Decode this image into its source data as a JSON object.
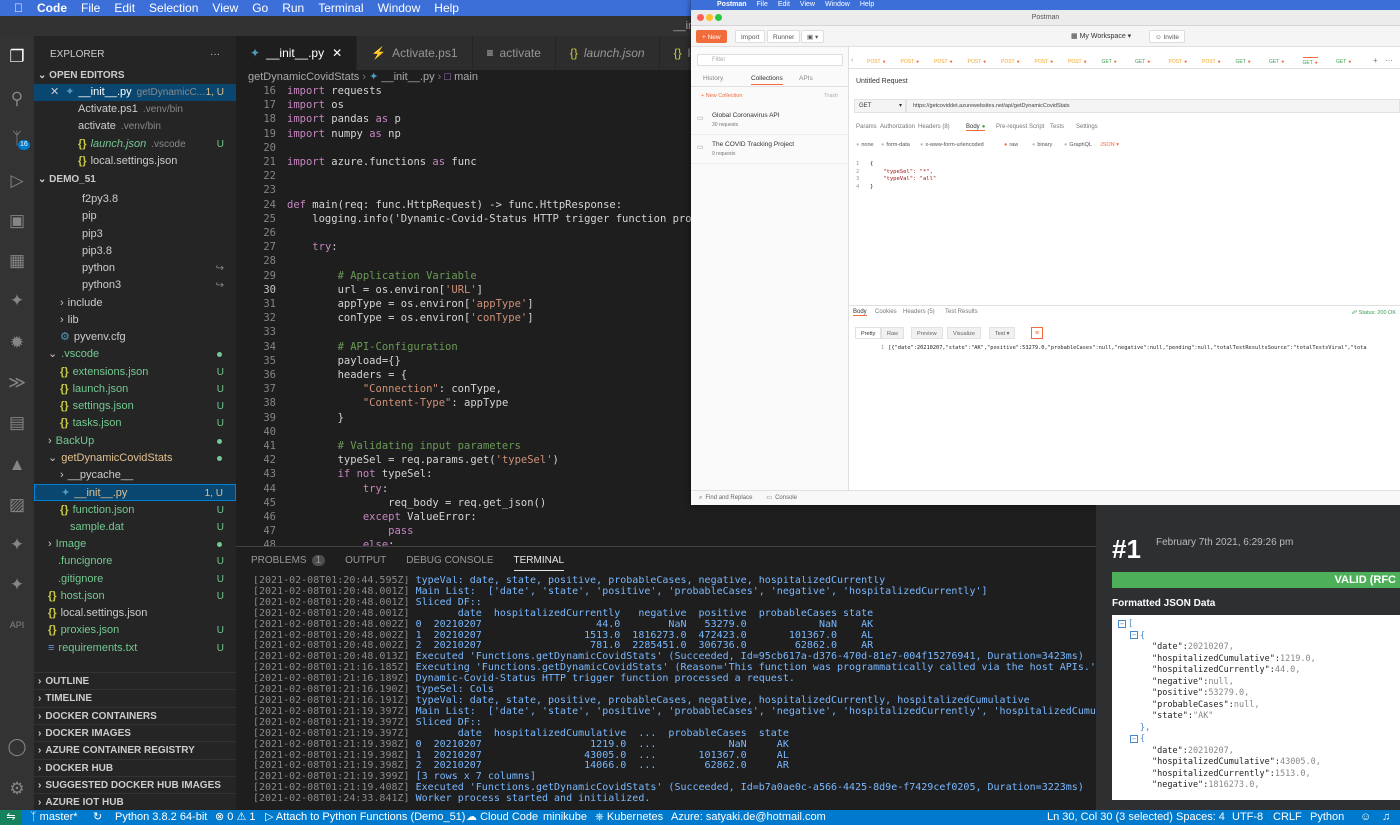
{
  "menubar": {
    "app": "Code",
    "items": [
      "File",
      "Edit",
      "Selection",
      "View",
      "Go",
      "Run",
      "Terminal",
      "Window",
      "Help"
    ]
  },
  "window_title": "__init__.py",
  "activity": {
    "source_control_badge": "16",
    "api_label": "API"
  },
  "explorer": {
    "title": "EXPLORER",
    "more": "···",
    "open_editors_label": "OPEN EDITORS",
    "open_editors": [
      {
        "name": "__init__.py",
        "path": "getDynamicC...",
        "status": "1, U",
        "active": true
      },
      {
        "name": "Activate.ps1",
        "path": ".venv/bin",
        "status": ""
      },
      {
        "name": "activate",
        "path": ".venv/bin",
        "status": ""
      },
      {
        "name": "launch.json",
        "path": ".vscode",
        "status": "U"
      },
      {
        "name": "local.settings.json",
        "path": "",
        "status": ""
      }
    ],
    "project_label": "DEMO_51",
    "tree": [
      {
        "name": "f2py3.8",
        "indent": 2,
        "status": ""
      },
      {
        "name": "pip",
        "indent": 2,
        "status": ""
      },
      {
        "name": "pip3",
        "indent": 2,
        "status": ""
      },
      {
        "name": "pip3.8",
        "indent": 2,
        "status": ""
      },
      {
        "name": "python",
        "indent": 2,
        "status": ""
      },
      {
        "name": "python3",
        "indent": 2,
        "status": ""
      },
      {
        "name": "include",
        "indent": 1,
        "status": ""
      },
      {
        "name": "lib",
        "indent": 1,
        "status": ""
      },
      {
        "name": "pyvenv.cfg",
        "indent": 1,
        "status": ""
      },
      {
        "name": ".vscode",
        "indent": 0,
        "status": "dot"
      },
      {
        "name": "extensions.json",
        "indent": 1,
        "status": "U"
      },
      {
        "name": "launch.json",
        "indent": 1,
        "status": "U"
      },
      {
        "name": "settings.json",
        "indent": 1,
        "status": "U"
      },
      {
        "name": "tasks.json",
        "indent": 1,
        "status": "U"
      },
      {
        "name": "BackUp",
        "indent": 0,
        "status": "dot"
      },
      {
        "name": "getDynamicCovidStats",
        "indent": 0,
        "status": "dot"
      },
      {
        "name": "__pycache__",
        "indent": 1,
        "status": ""
      },
      {
        "name": "__init__.py",
        "indent": 1,
        "status": "1, U"
      },
      {
        "name": "function.json",
        "indent": 1,
        "status": "U"
      },
      {
        "name": "sample.dat",
        "indent": 1,
        "status": "U"
      },
      {
        "name": "Image",
        "indent": 0,
        "status": "dot"
      },
      {
        "name": ".funcignore",
        "indent": 0,
        "status": "U"
      },
      {
        "name": ".gitignore",
        "indent": 0,
        "status": "U"
      },
      {
        "name": "host.json",
        "indent": 0,
        "status": "U"
      },
      {
        "name": "local.settings.json",
        "indent": 0,
        "status": ""
      },
      {
        "name": "proxies.json",
        "indent": 0,
        "status": "U"
      },
      {
        "name": "requirements.txt",
        "indent": 0,
        "status": "U"
      }
    ],
    "sections": [
      "OUTLINE",
      "TIMELINE",
      "DOCKER CONTAINERS",
      "DOCKER IMAGES",
      "AZURE CONTAINER REGISTRY",
      "DOCKER HUB",
      "SUGGESTED DOCKER HUB IMAGES",
      "AZURE IOT HUB"
    ]
  },
  "tabs": [
    "__init__.py",
    "Activate.ps1",
    "activate",
    "launch.json",
    "local.s"
  ],
  "breadcrumbs": {
    "folder": "getDynamicCovidStats",
    "file": "__init__.py",
    "symbol": "main"
  },
  "editor": {
    "current_line": 30,
    "lines": [
      {
        "n": 16,
        "t": "import requests"
      },
      {
        "n": 17,
        "t": "import os"
      },
      {
        "n": 18,
        "t": "import pandas as p"
      },
      {
        "n": 19,
        "t": "import numpy as np"
      },
      {
        "n": 20,
        "t": ""
      },
      {
        "n": 21,
        "t": "import azure.functions as func"
      },
      {
        "n": 22,
        "t": ""
      },
      {
        "n": 23,
        "t": ""
      },
      {
        "n": 24,
        "t": "def main(req: func.HttpRequest) -> func.HttpResponse:"
      },
      {
        "n": 25,
        "t": "    logging.info('Dynamic-Covid-Status HTTP trigger function processed a"
      },
      {
        "n": 26,
        "t": ""
      },
      {
        "n": 27,
        "t": "    try:"
      },
      {
        "n": 28,
        "t": ""
      },
      {
        "n": 29,
        "t": "        # Application Variable"
      },
      {
        "n": 30,
        "t": "        url = os.environ['URL']"
      },
      {
        "n": 31,
        "t": "        appType = os.environ['appType']"
      },
      {
        "n": 32,
        "t": "        conType = os.environ['conType']"
      },
      {
        "n": 33,
        "t": ""
      },
      {
        "n": 34,
        "t": "        # API-Configuration"
      },
      {
        "n": 35,
        "t": "        payload={}"
      },
      {
        "n": 36,
        "t": "        headers = {"
      },
      {
        "n": 37,
        "t": "            \"Connection\": conType,"
      },
      {
        "n": 38,
        "t": "            \"Content-Type\": appType"
      },
      {
        "n": 39,
        "t": "        }"
      },
      {
        "n": 40,
        "t": ""
      },
      {
        "n": 41,
        "t": "        # Validating input parameters"
      },
      {
        "n": 42,
        "t": "        typeSel = req.params.get('typeSel')"
      },
      {
        "n": 43,
        "t": "        if not typeSel:"
      },
      {
        "n": 44,
        "t": "            try:"
      },
      {
        "n": 45,
        "t": "                req_body = req.get_json()"
      },
      {
        "n": 46,
        "t": "            except ValueError:"
      },
      {
        "n": 47,
        "t": "                pass"
      },
      {
        "n": 48,
        "t": "            else:"
      }
    ]
  },
  "panel": {
    "tabs": [
      "PROBLEMS",
      "OUTPUT",
      "DEBUG CONSOLE",
      "TERMINAL"
    ],
    "problems_count": "1",
    "terminal": [
      "[2021-02-08T01:20:44.595Z] typeVal: date, state, positive, probableCases, negative, hospitalizedCurrently",
      "[2021-02-08T01:20:48.001Z] Main List:  ['date', 'state', 'positive', 'probableCases', 'negative', 'hospitalizedCurrently']",
      "[2021-02-08T01:20:48.001Z] Sliced DF::",
      "[2021-02-08T01:20:48.001Z]        date  hospitalizedCurrently   negative  positive  probableCases state",
      "[2021-02-08T01:20:48.002Z] 0  20210207                   44.0        NaN   53279.0            NaN    AK",
      "[2021-02-08T01:20:48.002Z] 1  20210207                 1513.0  1816273.0  472423.0       101367.0    AL",
      "[2021-02-08T01:20:48.002Z] 2  20210207                  781.0  2285451.0  306736.0        62862.0    AR",
      "[2021-02-08T01:20:48.013Z] Executed 'Functions.getDynamicCovidStats' (Succeeded, Id=95cb617a-d376-470d-81e7-004f15276941, Duration=3423ms)",
      "[2021-02-08T01:21:16.185Z] Executing 'Functions.getDynamicCovidStats' (Reason='This function was programmatically called via the host APIs.', Id=b7a0ae0c-",
      "[2021-02-08T01:21:16.189Z] Dynamic-Covid-Status HTTP trigger function processed a request.",
      "[2021-02-08T01:21:16.190Z] typeSel: Cols",
      "[2021-02-08T01:21:16.191Z] typeVal: date, state, positive, probableCases, negative, hospitalizedCurrently, hospitalizedCumulative",
      "[2021-02-08T01:21:19.397Z] Main List:  ['date', 'state', 'positive', 'probableCases', 'negative', 'hospitalizedCurrently', 'hospitalizedCumulative']",
      "[2021-02-08T01:21:19.397Z] Sliced DF::",
      "[2021-02-08T01:21:19.397Z]        date  hospitalizedCumulative  ...  probableCases  state",
      "[2021-02-08T01:21:19.398Z] 0  20210207                  1219.0  ...            NaN     AK",
      "[2021-02-08T01:21:19.398Z] 1  20210207                 43005.0  ...       101367.0     AL",
      "[2021-02-08T01:21:19.398Z] 2  20210207                 14066.0  ...        62862.0     AR",
      "[2021-02-08T01:21:19.399Z] [3 rows x 7 columns]",
      "[2021-02-08T01:21:19.408Z] Executed 'Functions.getDynamicCovidStats' (Succeeded, Id=b7a0ae0c-a566-4425-8d9e-f7429cef0205, Duration=3223ms)",
      "[2021-02-08T01:24:33.841Z] Worker process started and initialized."
    ]
  },
  "statusbar": {
    "branch": "master*",
    "python": "Python 3.8.2 64-bit",
    "errors": "0",
    "warnings": "1",
    "attach": "Attach to Python Functions (Demo_51)",
    "cloud": "Cloud Code",
    "minikube": "minikube",
    "k8s": "Kubernetes",
    "azure": "Azure: satyaki.de@hotmail.com",
    "position": "Ln 30, Col 30 (3 selected)",
    "spaces": "Spaces: 4",
    "encoding": "UTF-8",
    "eol": "CRLF",
    "lang": "Python"
  },
  "postman": {
    "menubar": [
      "Postman",
      "File",
      "Edit",
      "View",
      "Window",
      "Help"
    ],
    "title": "Postman",
    "new_btn": "+ New",
    "import_btn": "Import",
    "runner_btn": "Runner",
    "workspace": "My Workspace",
    "invite": "Invite",
    "filter_placeholder": "Filter",
    "side_tabs": [
      "History",
      "Collections",
      "APIs"
    ],
    "new_collection": "+ New Collection",
    "trash": "Trash",
    "collections": [
      {
        "name": "Global Coronavirus API",
        "count": "30 requests"
      },
      {
        "name": "The COVID Tracking Project",
        "count": "9 requests"
      }
    ],
    "request_name": "Untitled Request",
    "method": "GET",
    "url": "https://getcoviddet.azurewebsites.net/api/getDynamicCovidStats",
    "req_tabs": [
      "Params",
      "Authorization",
      "Headers (8)",
      "Body",
      "Pre-request Script",
      "Tests",
      "Settings"
    ],
    "body_types": [
      "none",
      "form-data",
      "x-www-form-urlencoded",
      "raw",
      "binary",
      "GraphQL"
    ],
    "body_format": "JSON",
    "body_lines": [
      "{",
      "    \"typeSel\": \"*\",",
      "    \"typeVal\": \"all\"",
      "}"
    ],
    "resp_tabs": [
      "Body",
      "Cookies",
      "Headers (5)",
      "Test Results"
    ],
    "status": "Status: 200 OK",
    "resp_views": [
      "Pretty",
      "Raw",
      "Preview",
      "Visualize"
    ],
    "resp_format": "Text",
    "response": "[{\"date\":20210207,\"state\":\"AK\",\"positive\":53279.0,\"probableCases\":null,\"negative\":null,\"pending\":null,\"totalTestResultsSource\":\"totalTestsViral\",\"tota",
    "footer": [
      "Find and Replace",
      "Console"
    ],
    "req_tab_prefix": [
      "POST",
      "POST",
      "POST",
      "POST",
      "POST",
      "POST",
      "POST",
      "GET",
      "GET",
      "POST",
      "POST",
      "GET",
      "GET",
      "GET",
      "GET"
    ]
  },
  "jsonviewer": {
    "number": "#1",
    "date": "February 7th 2021, 6:29:26 pm",
    "valid": "VALID (RFC",
    "label": "Formatted JSON Data",
    "lines": [
      {
        "i": 0,
        "t": "[",
        "toggle": true
      },
      {
        "i": 1,
        "t": "{",
        "toggle": true
      },
      {
        "i": 2,
        "k": "\"date\"",
        "v": "20210207,"
      },
      {
        "i": 2,
        "k": "\"hospitalizedCumulative\"",
        "v": "1219.0,"
      },
      {
        "i": 2,
        "k": "\"hospitalizedCurrently\"",
        "v": "44.0,"
      },
      {
        "i": 2,
        "k": "\"negative\"",
        "v": "null,"
      },
      {
        "i": 2,
        "k": "\"positive\"",
        "v": "53279.0,"
      },
      {
        "i": 2,
        "k": "\"probableCases\"",
        "v": "null,"
      },
      {
        "i": 2,
        "k": "\"state\"",
        "v": "\"AK\""
      },
      {
        "i": 1,
        "t": "},"
      },
      {
        "i": 1,
        "t": "{",
        "toggle": true
      },
      {
        "i": 2,
        "k": "\"date\"",
        "v": "20210207,"
      },
      {
        "i": 2,
        "k": "\"hospitalizedCumulative\"",
        "v": "43005.0,"
      },
      {
        "i": 2,
        "k": "\"hospitalizedCurrently\"",
        "v": "1513.0,"
      },
      {
        "i": 2,
        "k": "\"negative\"",
        "v": "1816273.0,"
      }
    ]
  }
}
